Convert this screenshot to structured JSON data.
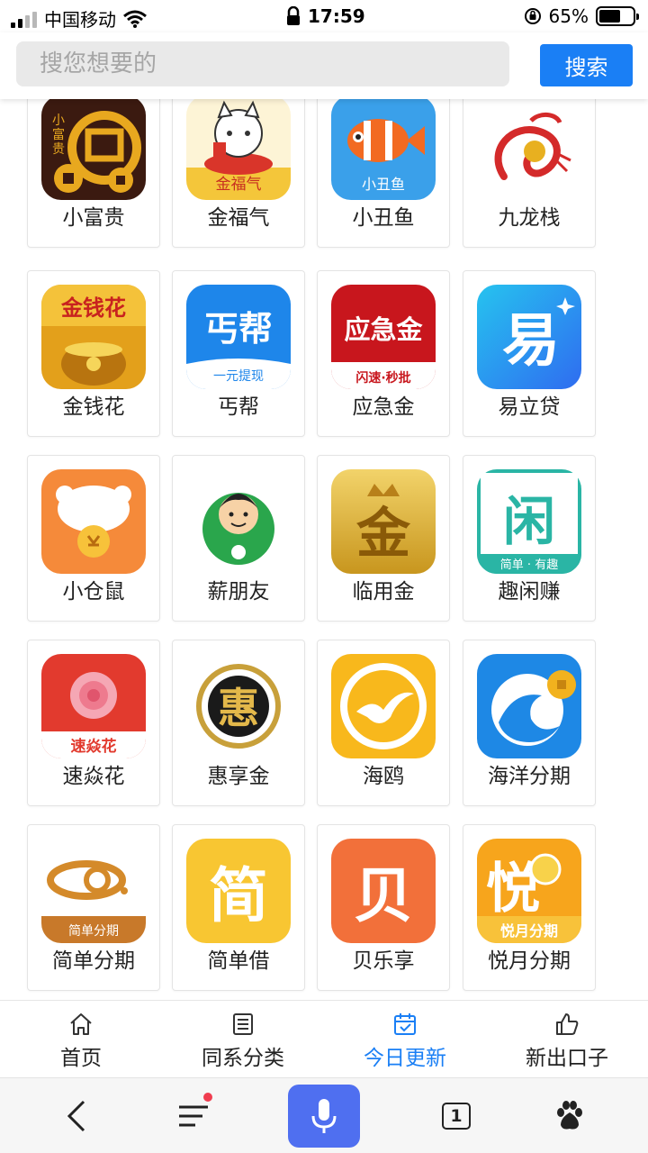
{
  "status_bar": {
    "carrier": "中国移动",
    "time": "17:59",
    "battery_percent": "65%",
    "battery_level": 0.65,
    "icons": [
      "signal-icon",
      "wifi-icon",
      "lock-icon",
      "orientation-lock-icon",
      "battery-icon"
    ]
  },
  "search": {
    "placeholder": "搜您想要的",
    "button_label": "搜索",
    "accent_color": "#1a7ff5"
  },
  "apps": [
    {
      "name": "小富贵",
      "icon": "xiaofugui-icon"
    },
    {
      "name": "金福气",
      "icon": "jinfuqi-icon"
    },
    {
      "name": "小丑鱼",
      "icon": "xiaochouyu-icon"
    },
    {
      "name": "九龙栈",
      "icon": "jiulongzhan-icon"
    },
    {
      "name": "金钱花",
      "icon": "jinqianhua-icon"
    },
    {
      "name": "丐帮",
      "icon": "gaibang-icon"
    },
    {
      "name": "应急金",
      "icon": "yingjijin-icon"
    },
    {
      "name": "易立贷",
      "icon": "yilidai-icon"
    },
    {
      "name": "小仓鼠",
      "icon": "xiaocangshu-icon"
    },
    {
      "name": "薪朋友",
      "icon": "xinpengyou-icon"
    },
    {
      "name": "临用金",
      "icon": "linyongjin-icon"
    },
    {
      "name": "趣闲赚",
      "icon": "quxianzhuan-icon"
    },
    {
      "name": "速焱花",
      "icon": "suyanhua-icon"
    },
    {
      "name": "惠享金",
      "icon": "huixiangjin-icon"
    },
    {
      "name": "海鸥",
      "icon": "haiou-icon"
    },
    {
      "name": "海洋分期",
      "icon": "haiyangfenqi-icon"
    },
    {
      "name": "简单分期",
      "icon": "jiandanfenqi-icon"
    },
    {
      "name": "简单借",
      "icon": "jiandanjie-icon"
    },
    {
      "name": "贝乐享",
      "icon": "beilexiang-icon"
    },
    {
      "name": "悦月分期",
      "icon": "yueyuefenqi-icon"
    }
  ],
  "icon_text": {
    "xiaofugui": [
      "小",
      "富",
      "贵"
    ],
    "jinfuqi": "金福气",
    "xiaochouyu": "小丑鱼",
    "jinqianhua": "金钱花",
    "gaibang": "丐帮",
    "gaibang_sub": "一元提现",
    "yingjijin": "应急金",
    "yingjijin_sub": "闪速·秒批",
    "yilidai": "易",
    "linyongjin": "金",
    "quxianzhuan": "闲",
    "quxianzhuan_sub": "简单 · 有趣",
    "suyanhua": "速焱花",
    "huixiangjin": "惠",
    "jiandanfenqi": "简单分期",
    "jiandanjie": "简",
    "beilexiang": "贝",
    "yueyue": "悦",
    "yueyue_sub": "悦月分期"
  },
  "tabs": [
    {
      "label": "首页",
      "icon": "home-icon",
      "active": false
    },
    {
      "label": "同系分类",
      "icon": "list-icon",
      "active": false
    },
    {
      "label": "今日更新",
      "icon": "calendar-check-icon",
      "active": true
    },
    {
      "label": "新出口子",
      "icon": "thumbs-up-icon",
      "active": false
    }
  ],
  "browser_toolbar": {
    "tab_count": "1",
    "buttons": [
      "back-icon",
      "menu-icon",
      "microphone-icon",
      "tabs-icon",
      "baidu-paw-icon"
    ]
  }
}
